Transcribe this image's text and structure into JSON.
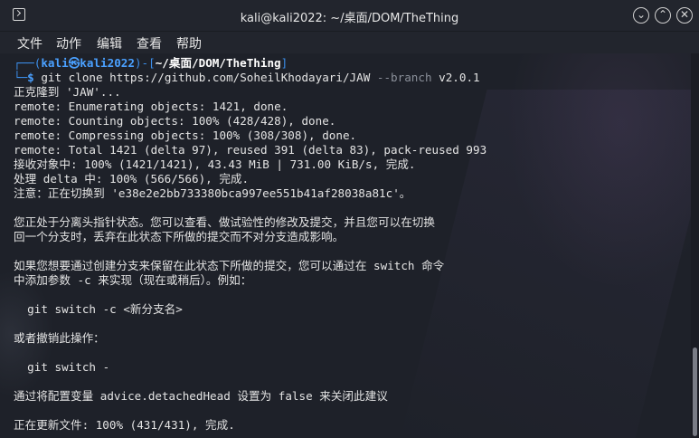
{
  "window": {
    "title": "kali@kali2022: ~/桌面/DOM/TheThing",
    "buttons": {
      "minimize": "⌄",
      "maximize": "⌃",
      "close": "✕"
    }
  },
  "menu": [
    "文件",
    "动作",
    "编辑",
    "查看",
    "帮助"
  ],
  "prompt": {
    "corner_top": "┌──(",
    "user": "kali",
    "at": "㉿",
    "host": "kali2022",
    "mid": ")-[",
    "path": "~/桌面/DOM/TheThing",
    "end": "]",
    "corner_bottom": "└─",
    "symbol": "$",
    "command_a": " git clone https://github.com/SoheilKhodayari/JAW ",
    "option": "--branch",
    "command_b": " v2.0.1"
  },
  "output": [
    "正克隆到 'JAW'...",
    "remote: Enumerating objects: 1421, done.",
    "remote: Counting objects: 100% (428/428), done.",
    "remote: Compressing objects: 100% (308/308), done.",
    "remote: Total 1421 (delta 97), reused 391 (delta 83), pack-reused 993",
    "接收对象中: 100% (1421/1421), 43.43 MiB | 731.00 KiB/s, 完成.",
    "处理 delta 中: 100% (566/566), 完成.",
    "注意：正在切换到 'e38e2e2bb733380bca997ee551b41af28038a81c'。",
    "",
    "您正处于分离头指针状态。您可以查看、做试验性的修改及提交，并且您可以在切换",
    "回一个分支时，丢弃在此状态下所做的提交而不对分支造成影响。",
    "",
    "如果您想要通过创建分支来保留在此状态下所做的提交，您可以通过在 switch 命令",
    "中添加参数 -c 来实现（现在或稍后）。例如：",
    "",
    "  git switch -c <新分支名>",
    "",
    "或者撤销此操作：",
    "",
    "  git switch -",
    "",
    "通过将配置变量 advice.detachedHead 设置为 false 来关闭此建议",
    "",
    "正在更新文件: 100% (431/431), 完成."
  ]
}
